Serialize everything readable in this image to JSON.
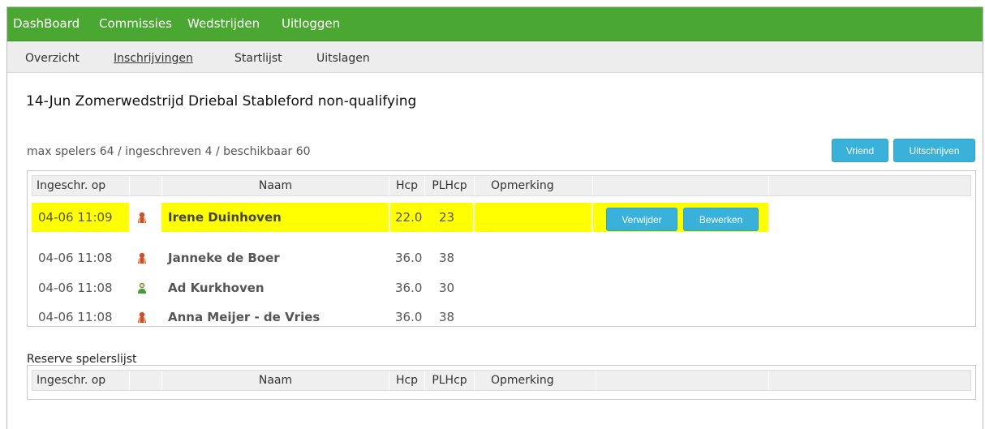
{
  "topnav": {
    "items": [
      {
        "label": "DashBoard"
      },
      {
        "label": "Commissies"
      },
      {
        "label": "Wedstrijden"
      },
      {
        "label": "Uitloggen"
      }
    ],
    "color": "#4aa832"
  },
  "subnav": {
    "items": [
      {
        "label": "Overzicht"
      },
      {
        "label": "Inschrijvingen"
      },
      {
        "label": "Startlijst"
      },
      {
        "label": "Uitslagen"
      }
    ],
    "active": "Inschrijvingen"
  },
  "competition": {
    "title": "14-Jun Zomerwedstrijd Driebal Stableford non-qualifying",
    "counts": "max spelers 64 / ingeschreven 4 / beschikbaar 60"
  },
  "actions": {
    "friend_label": "Vriend",
    "unsubscribe_label": "Uitschrijven"
  },
  "table": {
    "headers": {
      "registered": "Ingeschr. op",
      "name": "Naam",
      "hcp": "Hcp",
      "plhcp": "PLHcp",
      "remark": "Opmerking"
    },
    "rows": [
      {
        "registered": "04-06 11:09",
        "gender_icon": "female-player-icon",
        "name": "Irene Duinhoven",
        "hcp": "22.0",
        "plhcp": "23",
        "remark": "",
        "highlighted": true,
        "delete_label": "Verwijder",
        "edit_label": "Bewerken"
      },
      {
        "registered": "04-06 11:08",
        "gender_icon": "female-player-icon",
        "name": "Janneke de Boer",
        "hcp": "36.0",
        "plhcp": "38",
        "remark": ""
      },
      {
        "registered": "04-06 11:08",
        "gender_icon": "male-player-icon",
        "name": "Ad Kurkhoven",
        "hcp": "36.0",
        "plhcp": "30",
        "remark": ""
      },
      {
        "registered": "04-06 11:08",
        "gender_icon": "female-player-icon",
        "name": "Anna Meijer - de Vries",
        "hcp": "36.0",
        "plhcp": "38",
        "remark": ""
      }
    ]
  },
  "reserve": {
    "label": "Reserve spelerslijst",
    "headers": {
      "registered": "Ingeschr. op",
      "name": "Naam",
      "hcp": "Hcp",
      "plhcp": "PLHcp",
      "remark": "Opmerking"
    }
  },
  "colors": {
    "accent_button": "#3ab1d8",
    "highlight_row": "#ffff00",
    "female_icon": "#c8502a",
    "male_icon": "#4a9a3a"
  }
}
